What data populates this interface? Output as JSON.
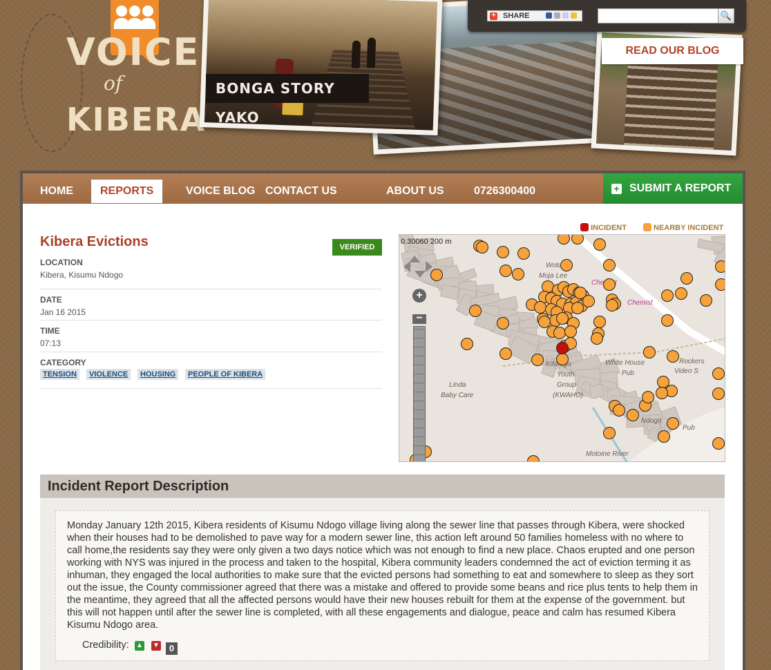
{
  "header": {
    "logo": {
      "line1": "VOICE",
      "line2": "of",
      "line3": "KIBERA"
    },
    "banner_label": "BONGA STORY YAKO",
    "share_label": "SHARE",
    "search": {
      "placeholder": "",
      "value": ""
    },
    "blog_button": "READ OUR BLOG"
  },
  "nav": {
    "items": [
      {
        "label": "HOME"
      },
      {
        "label": "REPORTS"
      },
      {
        "label": "VOICE BLOG"
      },
      {
        "label": "CONTACT US"
      },
      {
        "label": "ABOUT US"
      },
      {
        "label": "0726300400"
      }
    ],
    "active": "REPORTS",
    "submit_label": "SUBMIT A REPORT"
  },
  "report": {
    "title": "Kibera Evictions",
    "status": "VERIFIED",
    "location_label": "LOCATION",
    "location": "Kibera, Kisumu Ndogo",
    "date_label": "DATE",
    "date": "Jan 16 2015",
    "time_label": "TIME",
    "time": "07:13",
    "category_label": "CATEGORY",
    "categories": [
      "TENSION",
      "VIOLENCE",
      "HOUSING",
      "PEOPLE OF KIBERA"
    ]
  },
  "map": {
    "legend": {
      "incident": "INCIDENT",
      "nearby": "NEARBY INCIDENT"
    },
    "overlay_text": "0.30060  200 m",
    "place_labels": [
      "Wotu",
      "Moja Lee",
      "Linda",
      "Baby Care",
      "Kifafogo",
      "Youth",
      "Group",
      "(KWAHO)",
      "White House",
      "Pub",
      "Rockers",
      "Video S",
      "Ndogo",
      "Motoine River",
      "Chemist",
      "Chemist",
      "Pub"
    ],
    "colors": {
      "incident": "#c40f0f",
      "nearby": "#f7a23b",
      "land": "#e9e4dd",
      "block": "#cfc7c0"
    }
  },
  "description": {
    "heading": "Incident Report Description",
    "text": "Monday January 12th 2015, Kibera residents of Kisumu Ndogo village living along the sewer line that passes through Kibera, were shocked when their houses had to be demolished to pave way for a modern sewer line, this action left around 50 families homeless with no where to call home,the residents say they were only given a two days notice which was not enough to find a new place. Chaos erupted and one person working with NYS was injured in the process and taken to the hospital, Kibera community leaders condemned the act of eviction terming it as inhuman, they engaged the local authorities to make sure that the evicted persons had something to eat and somewhere to sleep as they sort out the issue, the County commissioner agreed that there was a mistake and offered to provide some beans and rice plus tents to help them in the meantime, they agreed that all the affected persons would have their new houses rebuilt for them at the expense of the government. but this will not happen until after the sewer line is completed, with all these engagements and dialogue, peace and calm has resumed Kibera Kisumu Ndogo area.",
    "credibility_label": "Credibility:",
    "credibility_value": "0"
  }
}
